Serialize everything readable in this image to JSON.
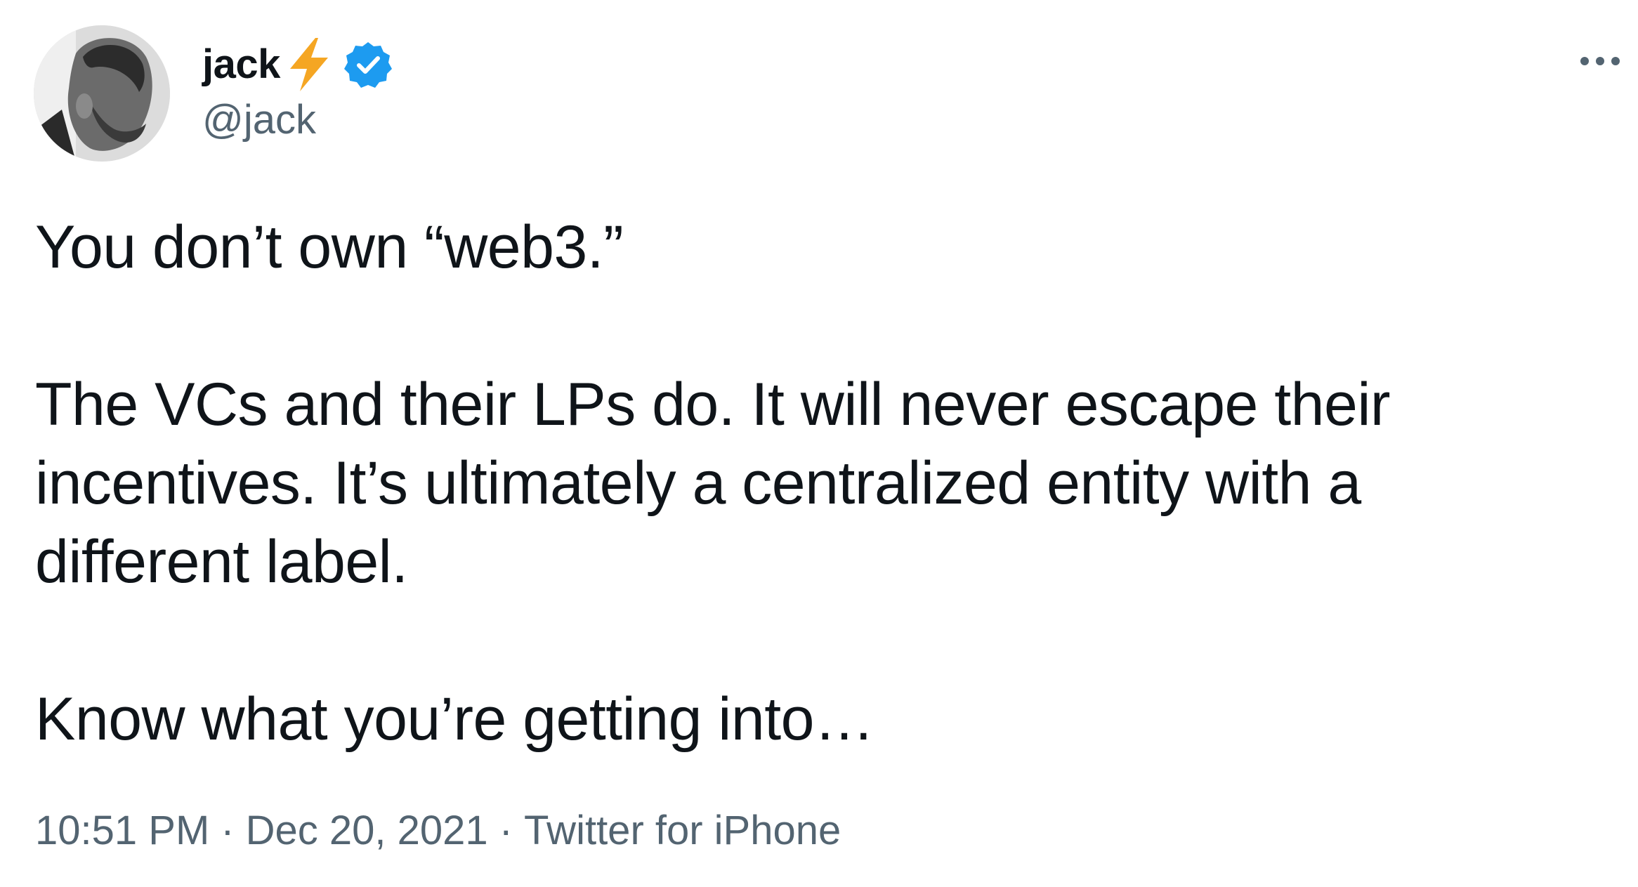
{
  "author": {
    "display_name": "jack",
    "handle": "@jack",
    "emoji_icon": "lightning-bolt-icon",
    "verified_icon": "verified-badge-icon",
    "verified_color": "#1d9bf0"
  },
  "menu": {
    "icon": "more-options-icon"
  },
  "tweet": {
    "paragraphs": [
      "You don’t own “web3.”",
      "The VCs and their LPs do. It will never escape their incentives. It’s ultimately a centralized entity with a different label.",
      "Know what you’re getting into…"
    ]
  },
  "meta": {
    "time": "10:51 PM",
    "date": "Dec 20, 2021",
    "source": "Twitter for iPhone",
    "separator": "·"
  },
  "colors": {
    "text_primary": "#0f1419",
    "text_secondary": "#536471",
    "bolt": "#f5a623"
  }
}
